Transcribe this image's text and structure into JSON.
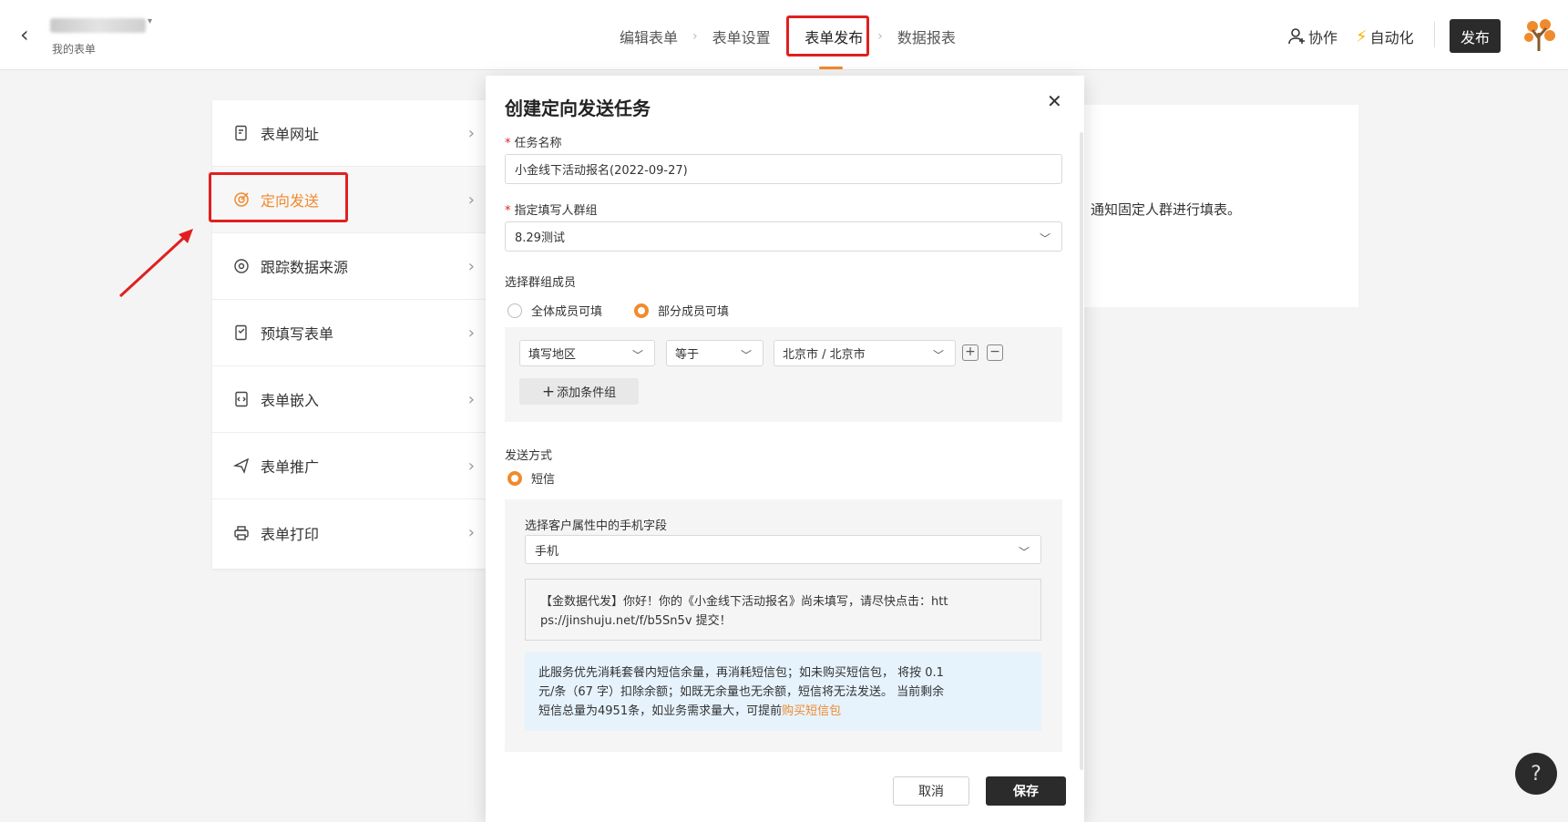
{
  "header": {
    "back_icon": "chevron-left-icon",
    "form_title": "",
    "sub_breadcrumb": "我的表单",
    "steps": [
      "编辑表单",
      "表单设置",
      "表单发布",
      "数据报表"
    ],
    "active_step": "表单发布",
    "collab_label": "协作",
    "auto_label": "自动化",
    "publish_label": "发布"
  },
  "sidebar": {
    "items": [
      {
        "label": "表单网址",
        "icon": "document-link-icon"
      },
      {
        "label": "定向发送",
        "icon": "target-send-icon",
        "active": true
      },
      {
        "label": "跟踪数据来源",
        "icon": "tracking-icon"
      },
      {
        "label": "预填写表单",
        "icon": "prefill-icon"
      },
      {
        "label": "表单嵌入",
        "icon": "embed-icon"
      },
      {
        "label": "表单推广",
        "icon": "send-plane-icon"
      },
      {
        "label": "表单打印",
        "icon": "printer-icon"
      }
    ]
  },
  "background_panel": {
    "text": "通知固定人群进行填表。"
  },
  "modal": {
    "title": "创建定向发送任务",
    "task_name_label": "任务名称",
    "task_name_value": "小金线下活动报名(2022-09-27)",
    "group_label": "指定填写人群组",
    "group_value": "8.29测试",
    "members_label": "选择群组成员",
    "member_options": [
      "全体成员可填",
      "部分成员可填"
    ],
    "member_selected": "部分成员可填",
    "condition": {
      "field": "填写地区",
      "operator": "等于",
      "value": "北京市 / 北京市",
      "add_button": "添加条件组"
    },
    "send_method_label": "发送方式",
    "send_method_option": "短信",
    "phone_field_label": "选择客户属性中的手机字段",
    "phone_field_value": "手机",
    "message_line1": "【金数据代发】你好！你的《小金线下活动报名》尚未填写，请尽快点击：htt",
    "message_line2": "ps://jinshuju.net/f/b5Sn5v 提交！",
    "info_line1": "此服务优先消耗套餐内短信余量，再消耗短信包；如未购买短信包， 将按 0.1",
    "info_line2": "元/条（67 字）扣除余额；如既无余量也无余额，短信将无法发送。 当前剩余",
    "info_line3": "短信总量为4951条，如业务需求量大，可提前",
    "info_link": "购买短信包",
    "cancel_label": "取消",
    "save_label": "保存"
  },
  "help_label": "?",
  "colors": {
    "accent": "#f08a2c",
    "highlight_red": "#e02020",
    "dark_button": "#2b2b2b",
    "info_bg": "#e6f3fd"
  }
}
